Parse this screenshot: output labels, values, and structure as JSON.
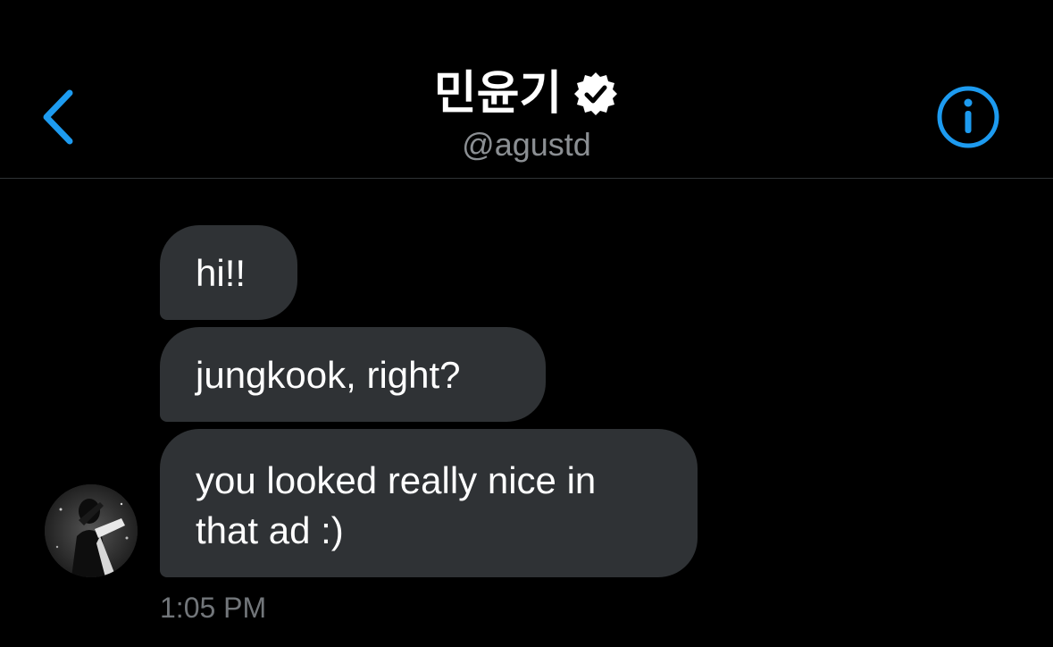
{
  "header": {
    "title": "민윤기",
    "handle": "@agustd",
    "back_icon": "chevron-left-icon",
    "verified_icon": "verified-badge-icon",
    "info_icon": "info-icon",
    "accent_color": "#1d9bf0"
  },
  "conversation": {
    "messages": [
      {
        "text": "hi!!"
      },
      {
        "text": "jungkook, right?"
      },
      {
        "text": "you looked really nice in that ad :)"
      }
    ],
    "timestamp": "1:05 PM",
    "bubble_color": "#2f3235"
  }
}
